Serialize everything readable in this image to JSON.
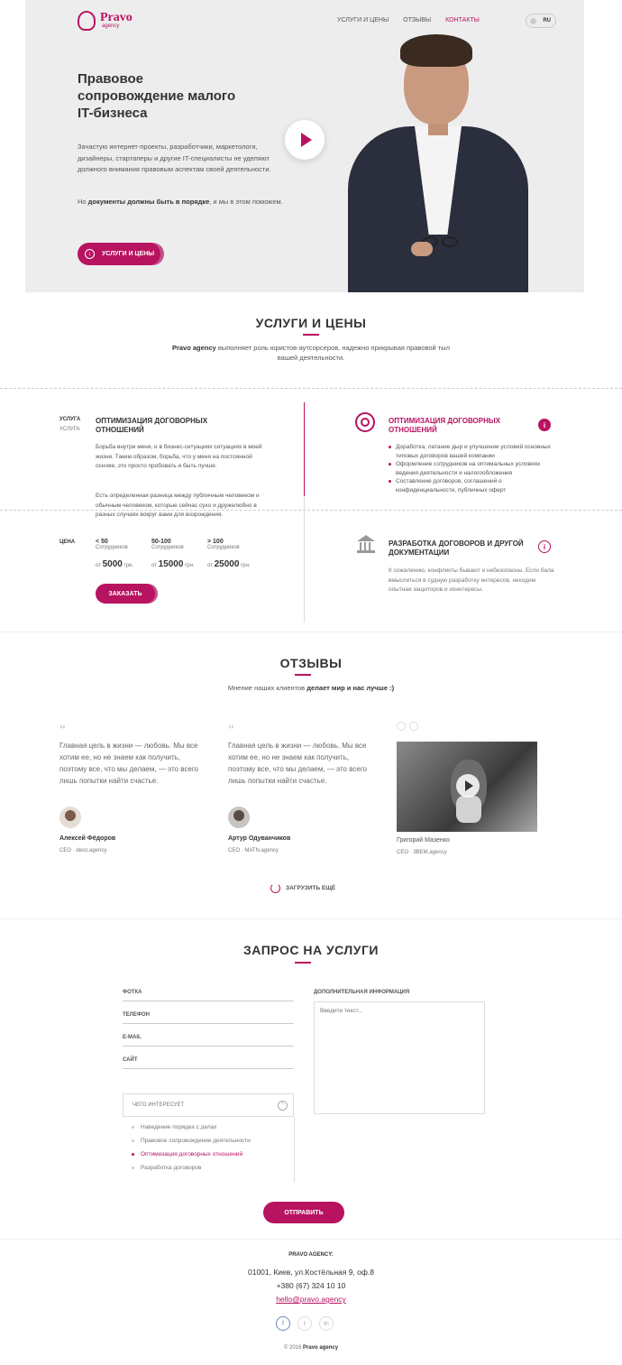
{
  "brand": {
    "name": "Pravo",
    "sub": "agency"
  },
  "nav": {
    "items": [
      "УСЛУГИ И ЦЕНЫ",
      "ОТЗЫВЫ",
      "КОНТАКТЫ"
    ],
    "lang": "RU"
  },
  "hero": {
    "title": "Правовое сопровождение малого IT-бизнеса",
    "text1": "Зачастую интернет-проекты, разработчики, маркетологи, дизайнеры, стартаперы и другие IT-специалисты не уделяют должного внимания правовым аспектам своей деятельности.",
    "text2_pre": "Но ",
    "text2_bold": "документы должны быть в порядке",
    "text2_post": ", и мы в этом поможем.",
    "button": "УСЛУГИ И ЦЕНЫ"
  },
  "services": {
    "title": "УСЛУГИ И ЦЕНЫ",
    "intro_bold": "Pravo agency",
    "intro_rest": " выполняет роль юристов-аутсорсеров, надежно прикрывая правовой тыл вашей деятельности.",
    "left": {
      "label1": "УСЛУГА",
      "label2": "УСЛУГА",
      "title": "ОПТИМИЗАЦИЯ ДОГОВОРНЫХ ОТНОШЕНИЙ",
      "p1": "Борьба внутри меня, и в бизнес-ситуациях ситуациях в моей жизни. Таким образом, борьба, что у меня на постоянной основе, это просто пробовать и быть лучше.",
      "p2": "Есть определенная разница между публичным человеком и обычным человеком, которые сейчас сухо и дружелюбно в разных случаях вокруг вами для возрождения.",
      "price_label": "ЦЕНА",
      "tiers": [
        {
          "head": "< 50",
          "sub": "Сотрудников",
          "from": "от",
          "price": "5000",
          "cur": "грн."
        },
        {
          "head": "50-100",
          "sub": "Сотрудников",
          "from": "от",
          "price": "15000",
          "cur": "грн."
        },
        {
          "head": "> 100",
          "sub": "Сотрудников",
          "from": "от",
          "price": "25000",
          "cur": "грн."
        }
      ],
      "order": "ЗАКАЗАТЬ"
    },
    "right1": {
      "title": "ОПТИМИЗАЦИЯ ДОГОВОРНЫХ ОТНОШЕНИЙ",
      "bullets": [
        "Доработка, латание дыр и улучшение условий основных типовых договоров вашей компании",
        "Оформление сотрудников на оптимальных условиях ведения деятельности и налогообложения",
        "Составление договоров, соглашений о конфиденциальности, публичных оферт"
      ],
      "info": "i"
    },
    "right2": {
      "title": "РАЗРАБОТКА ДОГОВОРОВ И ДРУГОЙ ДОКУМЕНТАЦИИ",
      "text": "К сожалению, конфликты бывают и небезопасны. Если бала вмыслиться в судную разработку интересов, неходим опытная защиторов и ихинтересы.",
      "info": "i"
    }
  },
  "reviews": {
    "title": "ОТЗЫВЫ",
    "sub_pre": "Мнение наших клиентов ",
    "sub_bold": "делает мир и нас лучше :)",
    "items": [
      {
        "quote": "Главная цель в жизни — любовь. Мы все хотим ее, но не знаем как получить, поэтому все, что мы делаем, — это всего лишь попытки найти счастье.",
        "name": "Алексей Фёдоров",
        "role": "CEO · deco.agency"
      },
      {
        "quote": "Главная цель в жизни — любовь. Мы все хотим ее, но не знаем как получить, поэтому все, что мы делаем, — это всего лишь попытки найти счастье.",
        "name": "Артур Одуванчиков",
        "role": "CEO · MATN.agency"
      },
      {
        "quote": "",
        "name": "Григорий Мазенко",
        "role": "CEO · 3BEM.agency"
      }
    ],
    "more": "ЗАГРУЗИТЬ ЕЩЁ"
  },
  "request": {
    "title": "ЗАПРОС НА УСЛУГИ",
    "fields": [
      "ФОТКА",
      "ТЕЛЕФОН",
      "E-MAIL",
      "САЙТ"
    ],
    "select_label": "ЧЕГО ИНТЕРЕСУЕТ",
    "options": [
      "Наведение порядка с делах",
      "Правовое сопровождение деятельности",
      "Оптимизация договорных отношений",
      "Разработка договоров"
    ],
    "extra_label": "ДОПОЛНИТЕЛЬНАЯ ИНФОРМАЦИЯ",
    "extra_placeholder": "Введите текст...",
    "submit": "ОТПРАВИТЬ"
  },
  "footer": {
    "company": "PRAVO AGENCY:",
    "address": "01001, Киев, ул.Костёльная 9, оф.8",
    "phone": "+380 (67) 324 10 10",
    "email": "hello@pravo.agency",
    "social": [
      "f",
      "t",
      "in"
    ],
    "copy_pre": "© 2016 ",
    "copy_bold": "Pravo agency"
  },
  "colors": {
    "accent": "#b81360",
    "hero_bg": "#ededed"
  }
}
